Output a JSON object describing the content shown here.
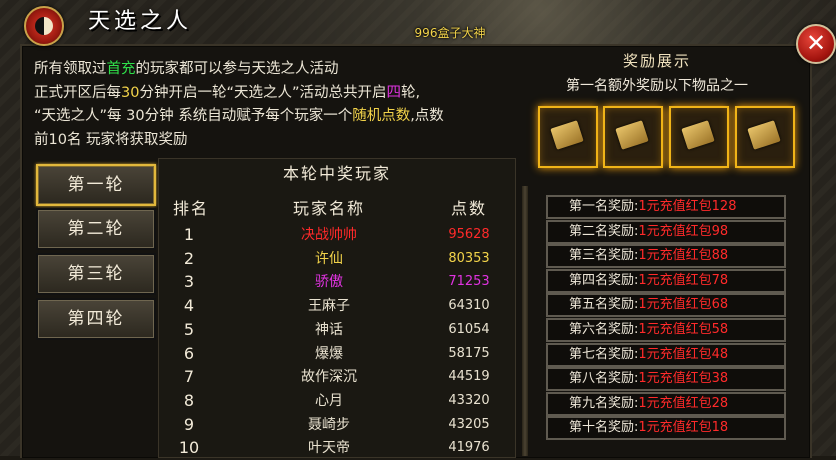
{
  "server_tag": "996盒子大神",
  "window": {
    "title": "天选之人",
    "close_glyph": "✕"
  },
  "intro": {
    "line1_a": "所有领取过",
    "line1_hl": "首充",
    "line1_b": "的玩家都可以参与天选之人活动",
    "line2_a": "正式开区后每",
    "line2_hl1": "30",
    "line2_b": "分钟开启一轮“天选之人”活动总共开启",
    "line2_hl2": "四",
    "line2_c": "轮,",
    "line3_a": "“天选之人”每 30分钟 系统自动赋予每个玩家一个",
    "line3_hl": "随机点数",
    "line3_b": ",点数",
    "line4": "前10名 玩家将获取奖励"
  },
  "reward_display": {
    "title": "奖励展示",
    "subtitle": "第一名额外奖励以下物品之一",
    "items": [
      "scroll-item-icon",
      "scroll-item-icon",
      "scroll-item-icon",
      "scroll-item-icon"
    ]
  },
  "tabs": [
    {
      "label": "第一轮",
      "active": true
    },
    {
      "label": "第二轮",
      "active": false
    },
    {
      "label": "第三轮",
      "active": false
    },
    {
      "label": "第四轮",
      "active": false
    }
  ],
  "ranking": {
    "title": "本轮中奖玩家",
    "headers": {
      "rank": "排名",
      "name": "玩家名称",
      "points": "点数"
    },
    "rows": [
      {
        "rank": "1",
        "name": "决战帅帅",
        "points": "95628",
        "color": "#ff2a2a"
      },
      {
        "rank": "2",
        "name": "许仙",
        "points": "80353",
        "color": "#f2d34a"
      },
      {
        "rank": "3",
        "name": "骄傲",
        "points": "71253",
        "color": "#e033e0"
      },
      {
        "rank": "4",
        "name": "王麻子",
        "points": "64310",
        "color": "#e9e2d0"
      },
      {
        "rank": "5",
        "name": "神话",
        "points": "61054",
        "color": "#e9e2d0"
      },
      {
        "rank": "6",
        "name": "爆爆",
        "points": "58175",
        "color": "#e9e2d0"
      },
      {
        "rank": "7",
        "name": "故作深沉",
        "points": "44519",
        "color": "#e9e2d0"
      },
      {
        "rank": "8",
        "name": "心月",
        "points": "43320",
        "color": "#e9e2d0"
      },
      {
        "rank": "9",
        "name": "聂崎步",
        "points": "43205",
        "color": "#e9e2d0"
      },
      {
        "rank": "10",
        "name": "叶天帝",
        "points": "41976",
        "color": "#e9e2d0"
      }
    ]
  },
  "awards": [
    {
      "label": "第一名奖励:",
      "value": "1元充值红包128"
    },
    {
      "label": "第二名奖励:",
      "value": "1元充值红包98"
    },
    {
      "label": "第三名奖励:",
      "value": "1元充值红包88"
    },
    {
      "label": "第四名奖励:",
      "value": "1元充值红包78"
    },
    {
      "label": "第五名奖励:",
      "value": "1元充值红包68"
    },
    {
      "label": "第六名奖励:",
      "value": "1元充值红包58"
    },
    {
      "label": "第七名奖励:",
      "value": "1元充值红包48"
    },
    {
      "label": "第八名奖励:",
      "value": "1元充值红包38"
    },
    {
      "label": "第九名奖励:",
      "value": "1元充值红包28"
    },
    {
      "label": "第十名奖励:",
      "value": "1元充值红包18"
    }
  ],
  "colors": {
    "highlight_green": "#2fe04a",
    "highlight_yellow": "#f2d34a",
    "highlight_magenta": "#e033e0",
    "reward_red": "#ff2a2a",
    "active_border": "#e2b83c"
  }
}
